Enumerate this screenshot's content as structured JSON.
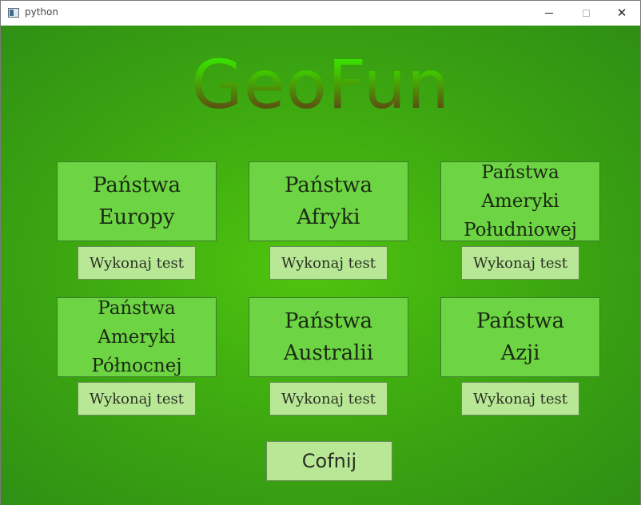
{
  "window": {
    "title": "python",
    "icon": "python-app-icon",
    "controls": {
      "minimize": "minimize-icon",
      "maximize": "maximize-icon",
      "close": "close-icon"
    }
  },
  "app": {
    "logo": "GeoFun",
    "colors": {
      "background": "#3eaa10",
      "card": "#6dd443",
      "button": "#b8e895",
      "logo_top": "#33ff00",
      "logo_bottom": "#4a3d10"
    }
  },
  "cards": [
    {
      "line1": "Państwa",
      "line2": "Europy",
      "button": "Wykonaj test"
    },
    {
      "line1": "Państwa",
      "line2": "Afryki",
      "button": "Wykonaj test"
    },
    {
      "line1": "Państwa Ameryki",
      "line2": "Południowej",
      "button": "Wykonaj test"
    },
    {
      "line1": "Państwa Ameryki",
      "line2": "Północnej",
      "button": "Wykonaj test"
    },
    {
      "line1": "Państwa",
      "line2": "Australii",
      "button": "Wykonaj test"
    },
    {
      "line1": "Państwa",
      "line2": "Azji",
      "button": "Wykonaj test"
    }
  ],
  "back_button": "Cofnij"
}
